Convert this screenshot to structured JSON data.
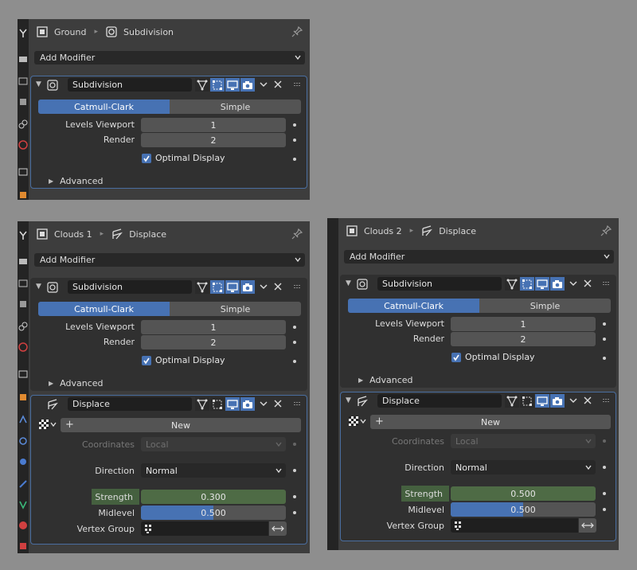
{
  "panels": [
    {
      "object_name": "Ground",
      "modifier_name": "Subdivision",
      "add_modifier_label": "Add Modifier",
      "subdivision": {
        "name": "Subdivision",
        "method_selected": "Catmull-Clark",
        "method_other": "Simple",
        "levels_viewport_label": "Levels Viewport",
        "levels_viewport": "1",
        "render_label": "Render",
        "render": "2",
        "optimal_display_label": "Optimal Display",
        "optimal_display_checked": true,
        "advanced_label": "Advanced"
      }
    },
    {
      "object_name": "Clouds 1",
      "modifier_name": "Displace",
      "add_modifier_label": "Add Modifier",
      "subdivision": {
        "name": "Subdivision",
        "method_selected": "Catmull-Clark",
        "method_other": "Simple",
        "levels_viewport_label": "Levels Viewport",
        "levels_viewport": "1",
        "render_label": "Render",
        "render": "2",
        "optimal_display_label": "Optimal Display",
        "optimal_display_checked": true,
        "advanced_label": "Advanced"
      },
      "displace": {
        "name": "Displace",
        "new_label": "New",
        "coordinates_label": "Coordinates",
        "coordinates": "Local",
        "direction_label": "Direction",
        "direction": "Normal",
        "strength_label": "Strength",
        "strength": "0.300",
        "midlevel_label": "Midlevel",
        "midlevel": "0.500",
        "midlevel_fraction": 0.5,
        "vertex_group_label": "Vertex Group"
      }
    },
    {
      "object_name": "Clouds 2",
      "modifier_name": "Displace",
      "add_modifier_label": "Add Modifier",
      "subdivision": {
        "name": "Subdivision",
        "method_selected": "Catmull-Clark",
        "method_other": "Simple",
        "levels_viewport_label": "Levels Viewport",
        "levels_viewport": "1",
        "render_label": "Render",
        "render": "2",
        "optimal_display_label": "Optimal Display",
        "optimal_display_checked": true,
        "advanced_label": "Advanced"
      },
      "displace": {
        "name": "Displace",
        "new_label": "New",
        "coordinates_label": "Coordinates",
        "coordinates": "Local",
        "direction_label": "Direction",
        "direction": "Normal",
        "strength_label": "Strength",
        "strength": "0.500",
        "midlevel_label": "Midlevel",
        "midlevel": "0.500",
        "midlevel_fraction": 0.5,
        "vertex_group_label": "Vertex Group"
      }
    }
  ],
  "colors": {
    "accent_blue": "#4772b3",
    "animated_green": "#4e6b45",
    "panel_bg": "#3d3d3d",
    "background": "#8e8e8e"
  }
}
